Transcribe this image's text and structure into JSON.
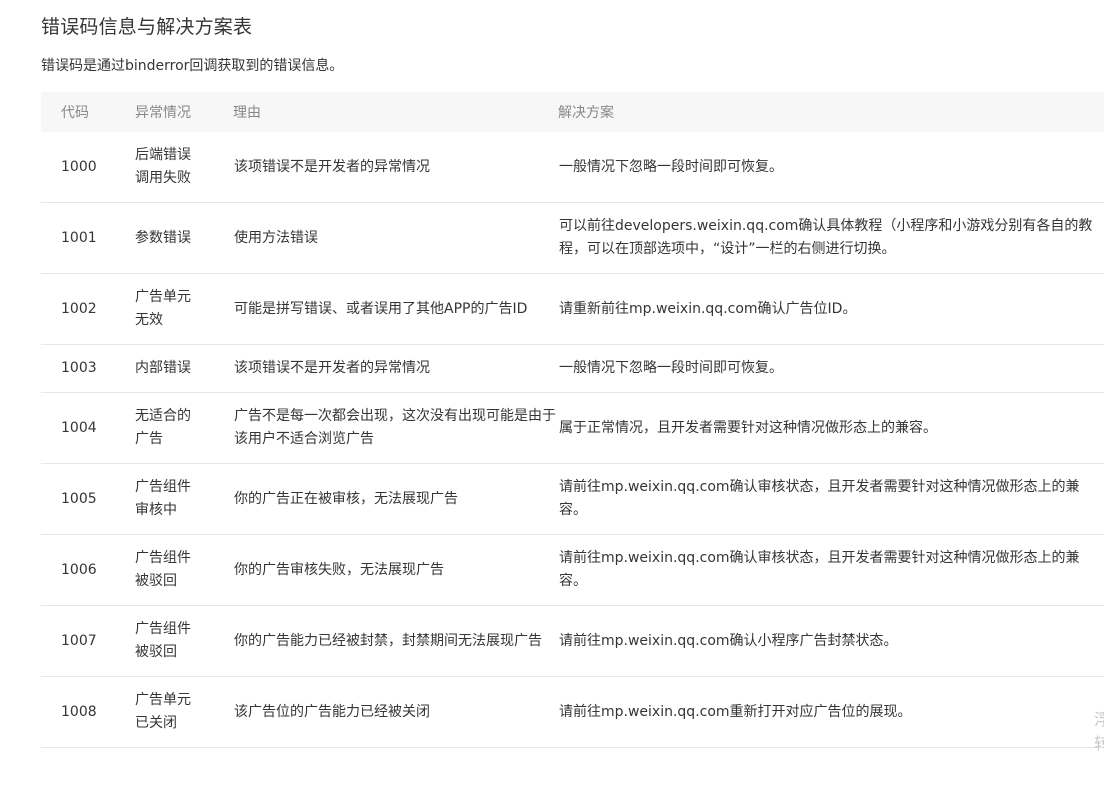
{
  "title": "错误码信息与解决方案表",
  "description": "错误码是通过binderror回调获取到的错误信息。",
  "table": {
    "headers": [
      "代码",
      "异常情况",
      "理由",
      "解决方案"
    ],
    "rows": [
      {
        "code": "1000",
        "situation": "后端错误调用失败",
        "reason": "该项错误不是开发者的异常情况",
        "solution": "一般情况下忽略一段时间即可恢复。"
      },
      {
        "code": "1001",
        "situation": "参数错误",
        "reason": "使用方法错误",
        "solution": "可以前往developers.weixin.qq.com确认具体教程（小程序和小游戏分别有各自的教程，可以在顶部选项中，“设计”一栏的右侧进行切换。"
      },
      {
        "code": "1002",
        "situation": "广告单元无效",
        "reason": "可能是拼写错误、或者误用了其他APP的广告ID",
        "solution": "请重新前往mp.weixin.qq.com确认广告位ID。"
      },
      {
        "code": "1003",
        "situation": "内部错误",
        "reason": "该项错误不是开发者的异常情况",
        "solution": "一般情况下忽略一段时间即可恢复。"
      },
      {
        "code": "1004",
        "situation": "无适合的广告",
        "reason": "广告不是每一次都会出现，这次没有出现可能是由于该用户不适合浏览广告",
        "solution": "属于正常情况，且开发者需要针对这种情况做形态上的兼容。"
      },
      {
        "code": "1005",
        "situation": "广告组件审核中",
        "reason": "你的广告正在被审核，无法展现广告",
        "solution": "请前往mp.weixin.qq.com确认审核状态，且开发者需要针对这种情况做形态上的兼容。"
      },
      {
        "code": "1006",
        "situation": "广告组件被驳回",
        "reason": "你的广告审核失败，无法展现广告",
        "solution": "请前往mp.weixin.qq.com确认审核状态，且开发者需要针对这种情况做形态上的兼容。"
      },
      {
        "code": "1007",
        "situation": "广告组件被驳回",
        "reason": "你的广告能力已经被封禁，封禁期间无法展现广告",
        "solution": "请前往mp.weixin.qq.com确认小程序广告封禁状态。"
      },
      {
        "code": "1008",
        "situation": "广告单元已关闭",
        "reason": "该广告位的广告能力已经被关闭",
        "solution": "请前往mp.weixin.qq.com重新打开对应广告位的展现。"
      }
    ]
  },
  "edge_text": [
    "浮",
    "转"
  ]
}
